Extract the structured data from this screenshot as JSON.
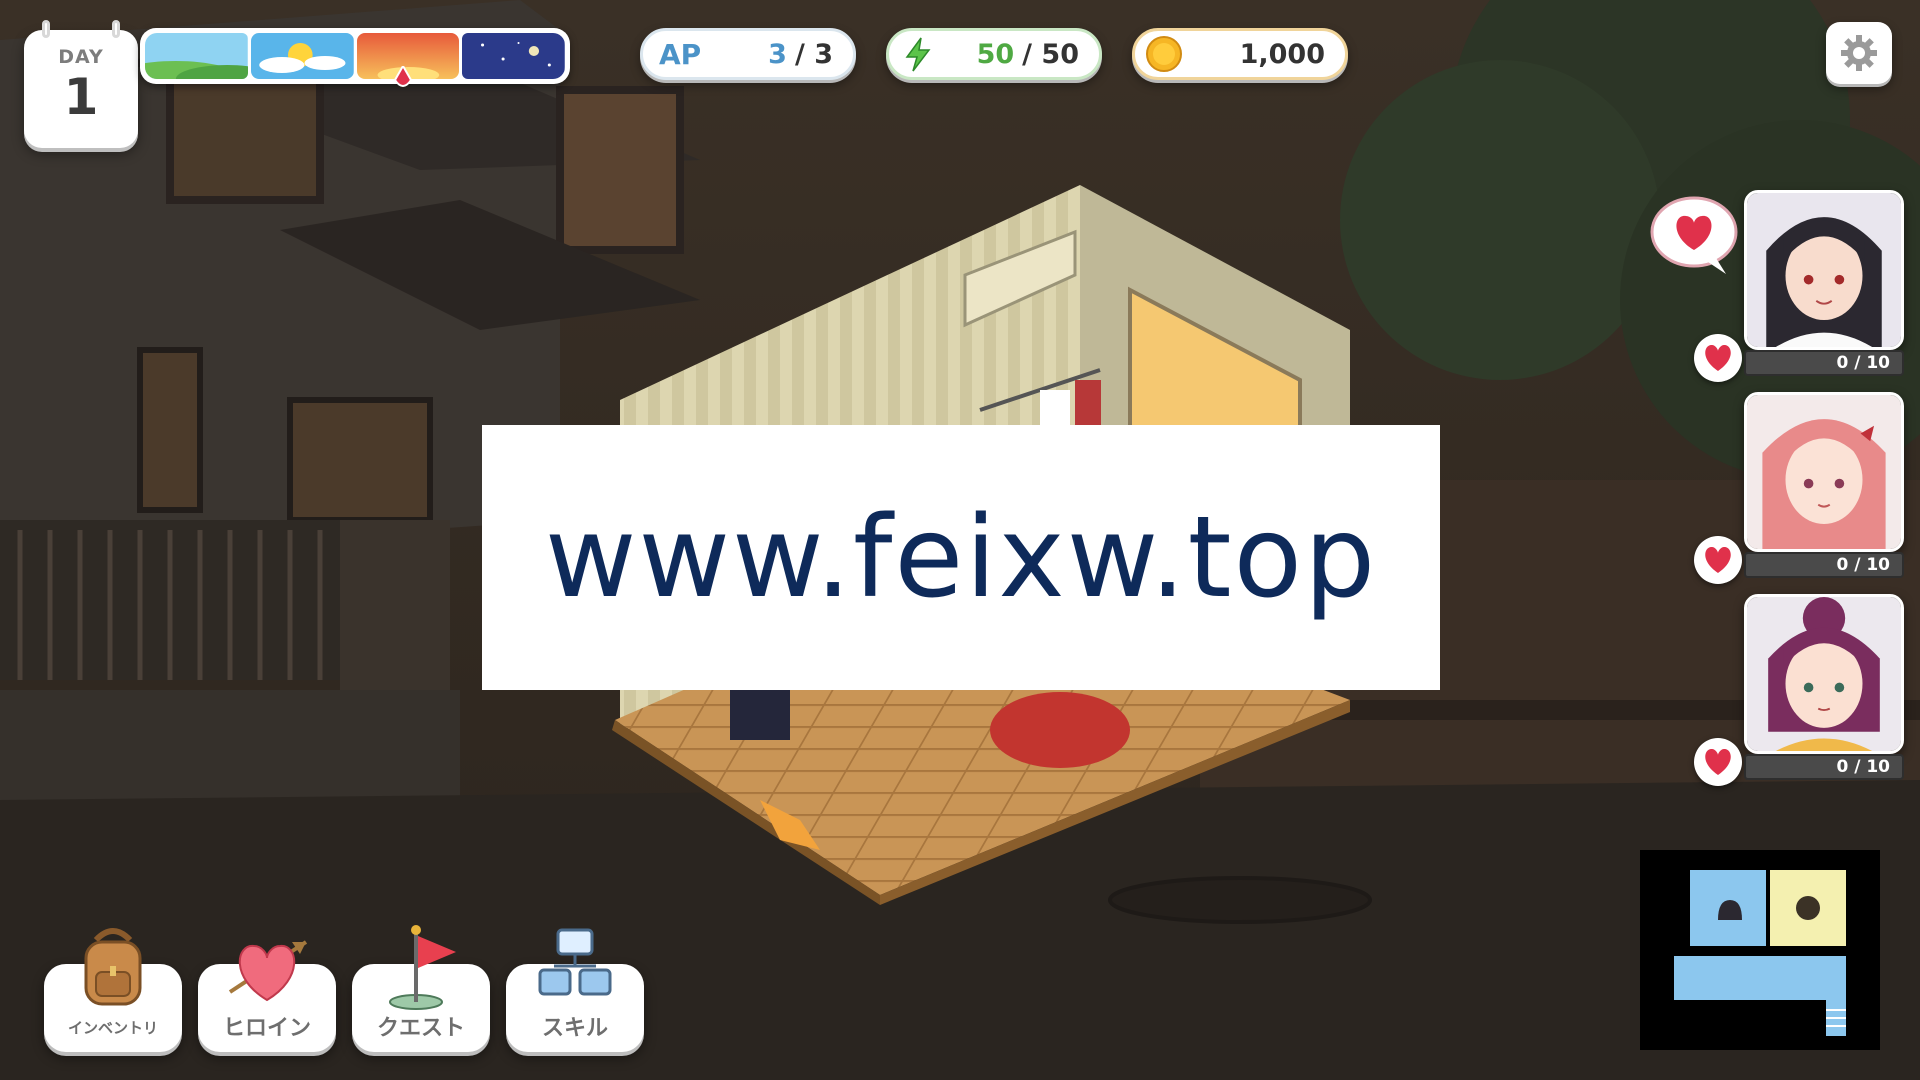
{
  "hud": {
    "day_label": "DAY",
    "day_number": "1",
    "time_of_day": [
      "morning",
      "noon",
      "evening",
      "night"
    ],
    "time_current_index": 2,
    "ap": {
      "label": "AP",
      "current": "3",
      "max": "/ 3"
    },
    "energy": {
      "icon": "lightning-icon",
      "current": "50",
      "max": "/ 50"
    },
    "gold": {
      "icon": "coin-icon",
      "value": "1,000"
    },
    "settings_icon": "gear-icon"
  },
  "heroines": [
    {
      "affection": "0 / 10",
      "hair_color": "#2b2830"
    },
    {
      "affection": "0 / 10",
      "hair_color": "#e88a8a"
    },
    {
      "affection": "0 / 10",
      "hair_color": "#7a2d5e"
    }
  ],
  "menu": [
    {
      "label": "インベントリ",
      "icon": "backpack-icon"
    },
    {
      "label": "ヒロイン",
      "icon": "heart-arrow-icon"
    },
    {
      "label": "クエスト",
      "icon": "flag-icon"
    },
    {
      "label": "スキル",
      "icon": "skill-tree-icon"
    }
  ],
  "watermark": "www.feixw.top",
  "colors": {
    "ap_blue": "#4b93c8",
    "energy_green": "#4fa943",
    "heart_red": "#e0314b",
    "minimap_blue": "#8cc7ee",
    "minimap_yellow": "#f4f0b0"
  }
}
